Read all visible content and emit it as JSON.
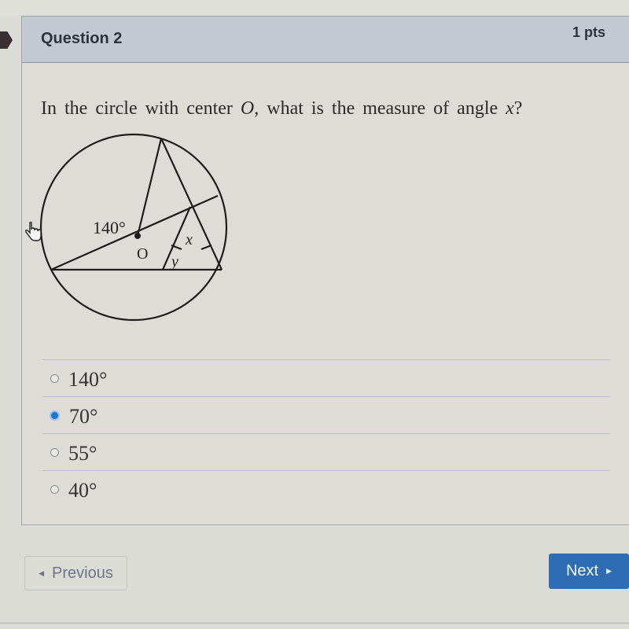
{
  "question": {
    "title": "Question 2",
    "points": "1 pts",
    "text_prefix": "In the circle with center ",
    "text_var_center": "O",
    "text_middle": ", what is the measure of angle ",
    "text_var_angle": "x",
    "text_suffix": "?"
  },
  "diagram": {
    "labels": {
      "angle": "140°",
      "center": "O",
      "x": "x",
      "y": "y"
    }
  },
  "answers": [
    {
      "label": "140°",
      "selected": false
    },
    {
      "label": "70°",
      "selected": true
    },
    {
      "label": "55°",
      "selected": false
    },
    {
      "label": "40°",
      "selected": false
    }
  ],
  "nav": {
    "previous_label": "Previous",
    "next_label": "Next"
  },
  "colors": {
    "accent": "#2e6db4",
    "selected_radio": "#1e73d6",
    "header_bg": "#c4c8d3"
  }
}
